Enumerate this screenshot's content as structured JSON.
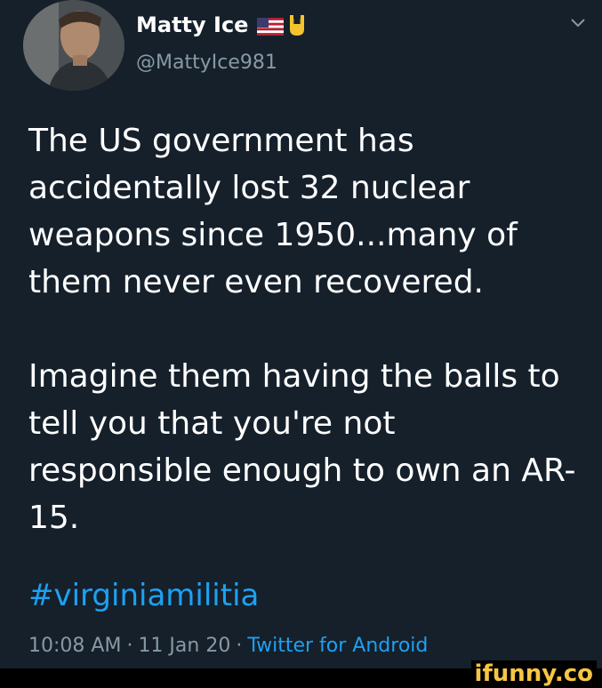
{
  "tweet": {
    "author": {
      "display_name": "Matty Ice",
      "handle": "@MattyIce981",
      "name_emojis": [
        "us-flag-icon",
        "sign-of-horns-icon"
      ]
    },
    "text_paragraphs": [
      "The US government has accidentally  lost 32 nuclear weapons since 1950...many of them never even recovered.",
      "Imagine them having the balls to tell you that you're not responsible enough to own an AR-15."
    ],
    "hashtag": "#virginiamilitia",
    "time": "10:08 AM",
    "date": "11 Jan 20",
    "separator": "·",
    "client": "Twitter for Android"
  },
  "watermark": "ifunny.co",
  "colors": {
    "background": "#15202b",
    "text": "#ffffff",
    "secondary_text": "#8899a6",
    "link": "#1da1f2",
    "watermark": "#f6c543"
  }
}
